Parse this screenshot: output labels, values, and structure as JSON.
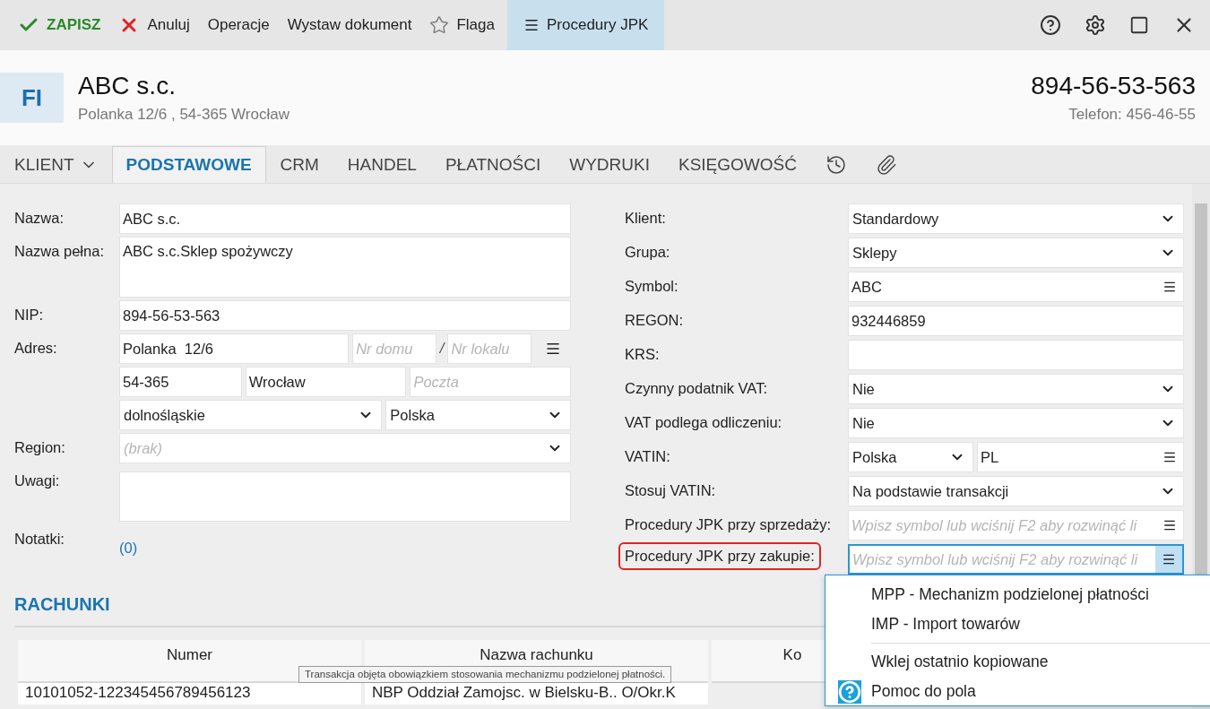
{
  "toolbar": [
    {
      "kind": "save",
      "label": "ZAPISZ",
      "selected": false
    },
    {
      "kind": "cancel",
      "label": "Anuluj",
      "selected": false
    },
    {
      "kind": "plain",
      "label": "Operacje",
      "selected": false
    },
    {
      "kind": "plain",
      "label": "Wystaw dokument",
      "selected": false
    },
    {
      "kind": "star",
      "label": "Flaga",
      "selected": false
    },
    {
      "kind": "menu",
      "label": "Procedury JPK",
      "selected": true
    }
  ],
  "header": {
    "badge": "FI",
    "name": "ABC s.c.",
    "address": "Polanka  12/6 , 54-365 Wrocław",
    "nip": "894-56-53-563",
    "phone": "Telefon: 456-46-55"
  },
  "tabs": [
    {
      "kind": "dropdown",
      "label": "KLIENT",
      "selected": false
    },
    {
      "kind": "text",
      "label": "PODSTAWOWE",
      "selected": true
    },
    {
      "kind": "text",
      "label": "CRM",
      "selected": false
    },
    {
      "kind": "text",
      "label": "HANDEL",
      "selected": false
    },
    {
      "kind": "text",
      "label": "PŁATNOŚCI",
      "selected": false
    },
    {
      "kind": "text",
      "label": "WYDRUKI",
      "selected": false
    },
    {
      "kind": "text",
      "label": "KSIĘGOWOŚĆ",
      "selected": false
    },
    {
      "kind": "history",
      "selected": false
    },
    {
      "kind": "attachment",
      "selected": false
    }
  ],
  "left_form": [
    {
      "label": "Nazwa:",
      "fields": [
        {
          "kind": "text",
          "value": "ABC s.c."
        }
      ]
    },
    {
      "label": "Nazwa pełna:",
      "fields": [
        {
          "kind": "textarea",
          "value": "ABC s.c.Sklep spożywczy"
        }
      ]
    },
    {
      "label": "NIP:",
      "fields": [
        {
          "kind": "text",
          "value": "894-56-53-563"
        }
      ]
    },
    {
      "label": "Adres:",
      "fields": [
        {
          "kind": "text",
          "value": "Polanka  12/6"
        },
        {
          "kind": "text",
          "placeholder": "Nr domu"
        },
        {
          "kind": "separator",
          "value": "/"
        },
        {
          "kind": "text",
          "placeholder": "Nr lokalu"
        },
        {
          "kind": "menu"
        }
      ]
    },
    {
      "fields": [
        {
          "kind": "text",
          "value": "54-365"
        },
        {
          "kind": "text",
          "value": "Wrocław"
        },
        {
          "kind": "text",
          "placeholder": "Poczta"
        }
      ]
    },
    {
      "fields": [
        {
          "kind": "select",
          "value": "dolnośląskie"
        },
        {
          "kind": "select",
          "value": "Polska"
        }
      ]
    },
    {
      "label": "Region:",
      "fields": [
        {
          "kind": "select",
          "placeholder": "(brak)"
        }
      ]
    },
    {
      "label": "Uwagi:",
      "fields": [
        {
          "kind": "textarea"
        }
      ]
    },
    {
      "label": "Notatki:",
      "fields": [
        {
          "kind": "link",
          "value": "(0)"
        }
      ]
    }
  ],
  "right_form": [
    {
      "label": "Klient:",
      "fields": [
        {
          "kind": "select",
          "value": "Standardowy"
        }
      ]
    },
    {
      "label": "Grupa:",
      "fields": [
        {
          "kind": "select",
          "value": "Sklepy"
        }
      ]
    },
    {
      "label": "Symbol:",
      "fields": [
        {
          "kind": "lookup",
          "value": "ABC"
        }
      ]
    },
    {
      "label": "REGON:",
      "fields": [
        {
          "kind": "text",
          "value": "932446859"
        }
      ]
    },
    {
      "label": "KRS:",
      "fields": [
        {
          "kind": "text"
        }
      ]
    },
    {
      "label": "Czynny podatnik VAT:",
      "fields": [
        {
          "kind": "select",
          "value": "Nie"
        }
      ]
    },
    {
      "label": "VAT podlega odliczeniu:",
      "fields": [
        {
          "kind": "select",
          "value": "Nie"
        }
      ]
    },
    {
      "label": "VATIN:",
      "fields": [
        {
          "kind": "select",
          "value": "Polska"
        },
        {
          "kind": "lookup",
          "value": "PL"
        }
      ]
    },
    {
      "label": "Stosuj VATIN:",
      "fields": [
        {
          "kind": "select",
          "value": "Na podstawie transakcji"
        }
      ]
    },
    {
      "label": "Procedury JPK przy sprzedaży:",
      "fields": [
        {
          "kind": "lookup",
          "placeholder": "Wpisz symbol lub wciśnij F2 aby rozwinąć li",
          "focused": false
        }
      ]
    },
    {
      "label": "Procedury JPK przy zakupie:",
      "highlighted": true,
      "fields": [
        {
          "kind": "lookup",
          "placeholder": "Wpisz symbol lub wciśnij F2 aby rozwinąć li",
          "focused": true
        }
      ]
    }
  ],
  "section_title": "RACHUNKI",
  "table": {
    "columns": [
      "Numer",
      "Nazwa rachunku",
      "Ko"
    ],
    "rows": [
      [
        "10101052-122345456789456123",
        "NBP Oddział Zamojsc. w Bielsku-B.. O/Okr.K"
      ]
    ]
  },
  "tooltip": "Transakcja objęta obowiązkiem stosowania mechanizmu podzielonej płatności.",
  "popup_menu": [
    {
      "kind": "item",
      "label": "MPP - Mechanizm podzielonej płatności"
    },
    {
      "kind": "item",
      "label": "IMP - Import towarów"
    },
    {
      "kind": "separator"
    },
    {
      "kind": "item",
      "label": "Wklej ostatnio kopiowane"
    },
    {
      "kind": "help",
      "label": "Pomoc do pola"
    }
  ]
}
